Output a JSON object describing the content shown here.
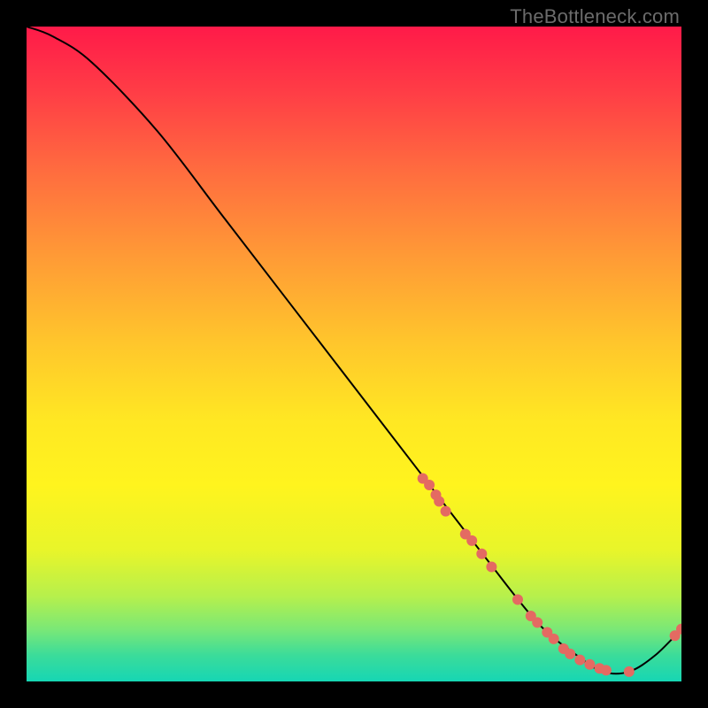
{
  "watermark": {
    "text": "TheBottleneck.com"
  },
  "chart_data": {
    "type": "line",
    "title": "",
    "xlabel": "",
    "ylabel": "",
    "xlim": [
      0,
      100
    ],
    "ylim": [
      0,
      100
    ],
    "grid": false,
    "legend": false,
    "background_gradient": {
      "direction": "vertical",
      "stops": [
        {
          "pos": 0.0,
          "color": "#ff1a49"
        },
        {
          "pos": 0.5,
          "color": "#ffd628"
        },
        {
          "pos": 1.0,
          "color": "#16d6b4"
        }
      ]
    },
    "series": [
      {
        "name": "bottleneck-curve",
        "color": "#000000",
        "x": [
          0,
          4,
          10,
          20,
          30,
          40,
          50,
          60,
          70,
          78,
          84,
          88,
          92,
          96,
          100
        ],
        "y": [
          100,
          98.5,
          94.5,
          84,
          71,
          58,
          45,
          32,
          19,
          9,
          4,
          1.5,
          1.5,
          4,
          8
        ]
      }
    ],
    "scatter": [
      {
        "name": "highlighted-points",
        "color": "#e46a62",
        "radius": 6,
        "x": [
          60.5,
          61.5,
          62.5,
          63.0,
          64.0,
          67.0,
          68.0,
          69.5,
          71.0,
          75.0,
          77.0,
          78.0,
          79.5,
          80.5,
          82.0,
          83.0,
          84.5,
          86.0,
          87.5,
          88.5,
          92.0,
          99.0,
          100.0
        ],
        "y": [
          31.0,
          30.0,
          28.5,
          27.5,
          26.0,
          22.5,
          21.5,
          19.5,
          17.5,
          12.5,
          10.0,
          9.0,
          7.5,
          6.5,
          5.0,
          4.2,
          3.3,
          2.6,
          2.0,
          1.7,
          1.5,
          7.0,
          8.0
        ]
      }
    ]
  }
}
